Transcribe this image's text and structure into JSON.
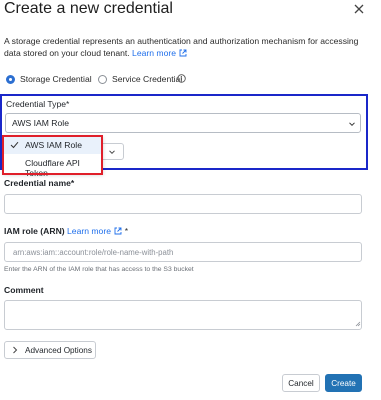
{
  "dialog": {
    "title": "Create a new credential",
    "description": "A storage credential represents an authentication and authorization mechanism for accessing data stored on your cloud tenant.",
    "learn_more": "Learn more"
  },
  "credential_kind": {
    "options": [
      {
        "label": "Storage Credential",
        "selected": true
      },
      {
        "label": "Service Credential",
        "selected": false
      }
    ],
    "info_icon": "info-icon"
  },
  "credential_type": {
    "label": "Credential Type*",
    "value": "AWS IAM Role",
    "dropdown_options": [
      {
        "label": "AWS IAM Role",
        "checked": true
      },
      {
        "label": "Cloudflare API Token",
        "checked": false
      }
    ]
  },
  "credential_name": {
    "label": "Credential name*",
    "value": ""
  },
  "iam_role": {
    "label": "IAM role (ARN)",
    "learn_more": "Learn more",
    "required_mark": "*",
    "placeholder": "arn:aws:iam::account:role/role-name-with-path",
    "hint": "Enter the ARN of the IAM role that has access to the S3 bucket"
  },
  "comment": {
    "label": "Comment",
    "value": ""
  },
  "advanced": {
    "label": "Advanced Options"
  },
  "footer": {
    "cancel": "Cancel",
    "create": "Create"
  },
  "colors": {
    "accent": "#2272b4",
    "link": "#1f6feb",
    "highlight_blue": "#1a27c9",
    "highlight_red": "#e01f2a"
  }
}
